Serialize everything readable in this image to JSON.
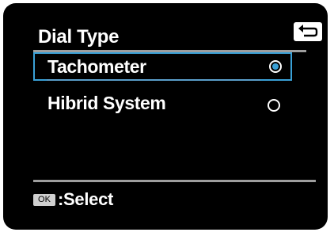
{
  "screen": {
    "title": "Dial Type",
    "back_icon": "return-arrow-icon"
  },
  "menu": {
    "items": [
      {
        "label": "Tachometer",
        "selected": true
      },
      {
        "label": "Hibrid System",
        "selected": false
      }
    ]
  },
  "footer": {
    "ok_key": "OK",
    "action_label": ":Select"
  },
  "colors": {
    "background": "#000000",
    "accent": "#3aa0d6",
    "divider": "#9e9e9e",
    "text": "#ffffff"
  }
}
